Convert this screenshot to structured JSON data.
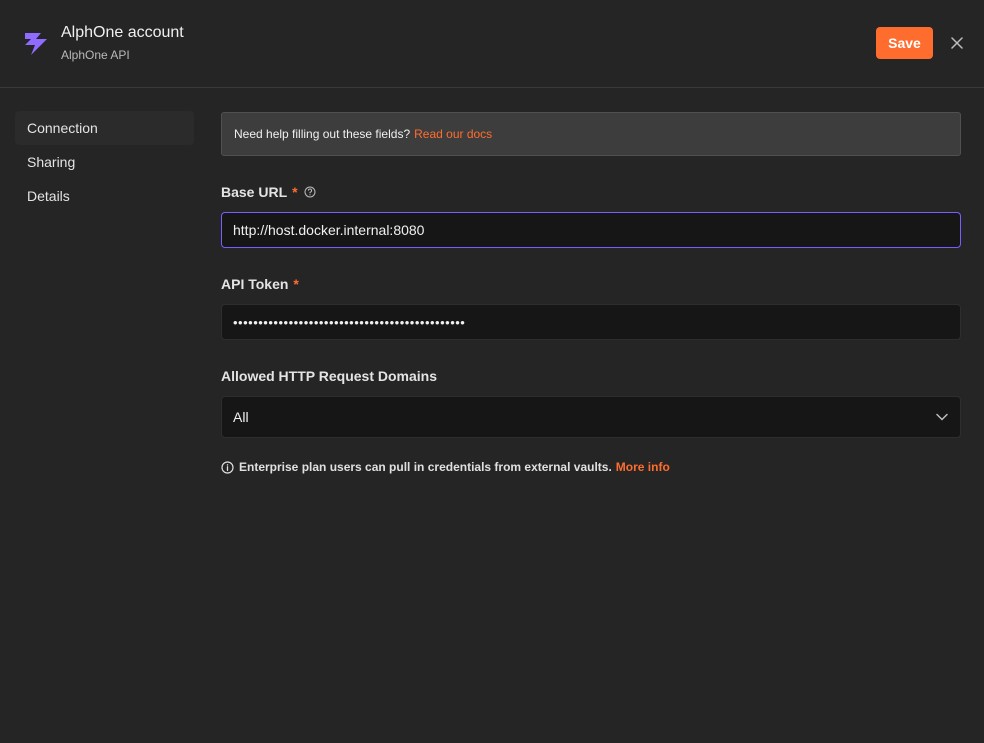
{
  "header": {
    "title": "AlphOne account",
    "subtitle": "AlphOne API",
    "save_label": "Save",
    "app_icon": "lightning-bolt-icon",
    "close_icon": "close-icon"
  },
  "sidebar": {
    "items": [
      {
        "label": "Connection",
        "active": true
      },
      {
        "label": "Sharing",
        "active": false
      },
      {
        "label": "Details",
        "active": false
      }
    ]
  },
  "info": {
    "text": "Need help filling out these fields?",
    "link": "Read our docs"
  },
  "fields": {
    "base_url": {
      "label": "Base URL",
      "required": "*",
      "value": "http://host.docker.internal:8080"
    },
    "api_token": {
      "label": "API Token",
      "required": "*",
      "value": "••••••••••••••••••••••••••••••••••••••••••••••"
    },
    "domains": {
      "label": "Allowed HTTP Request Domains",
      "value": "All"
    }
  },
  "note": {
    "text": "Enterprise plan users can pull in credentials from external vaults.",
    "link": "More info"
  },
  "colors": {
    "accent": "#ff6d2e",
    "focus": "#7c5cff",
    "icon": "#8f6bff"
  }
}
